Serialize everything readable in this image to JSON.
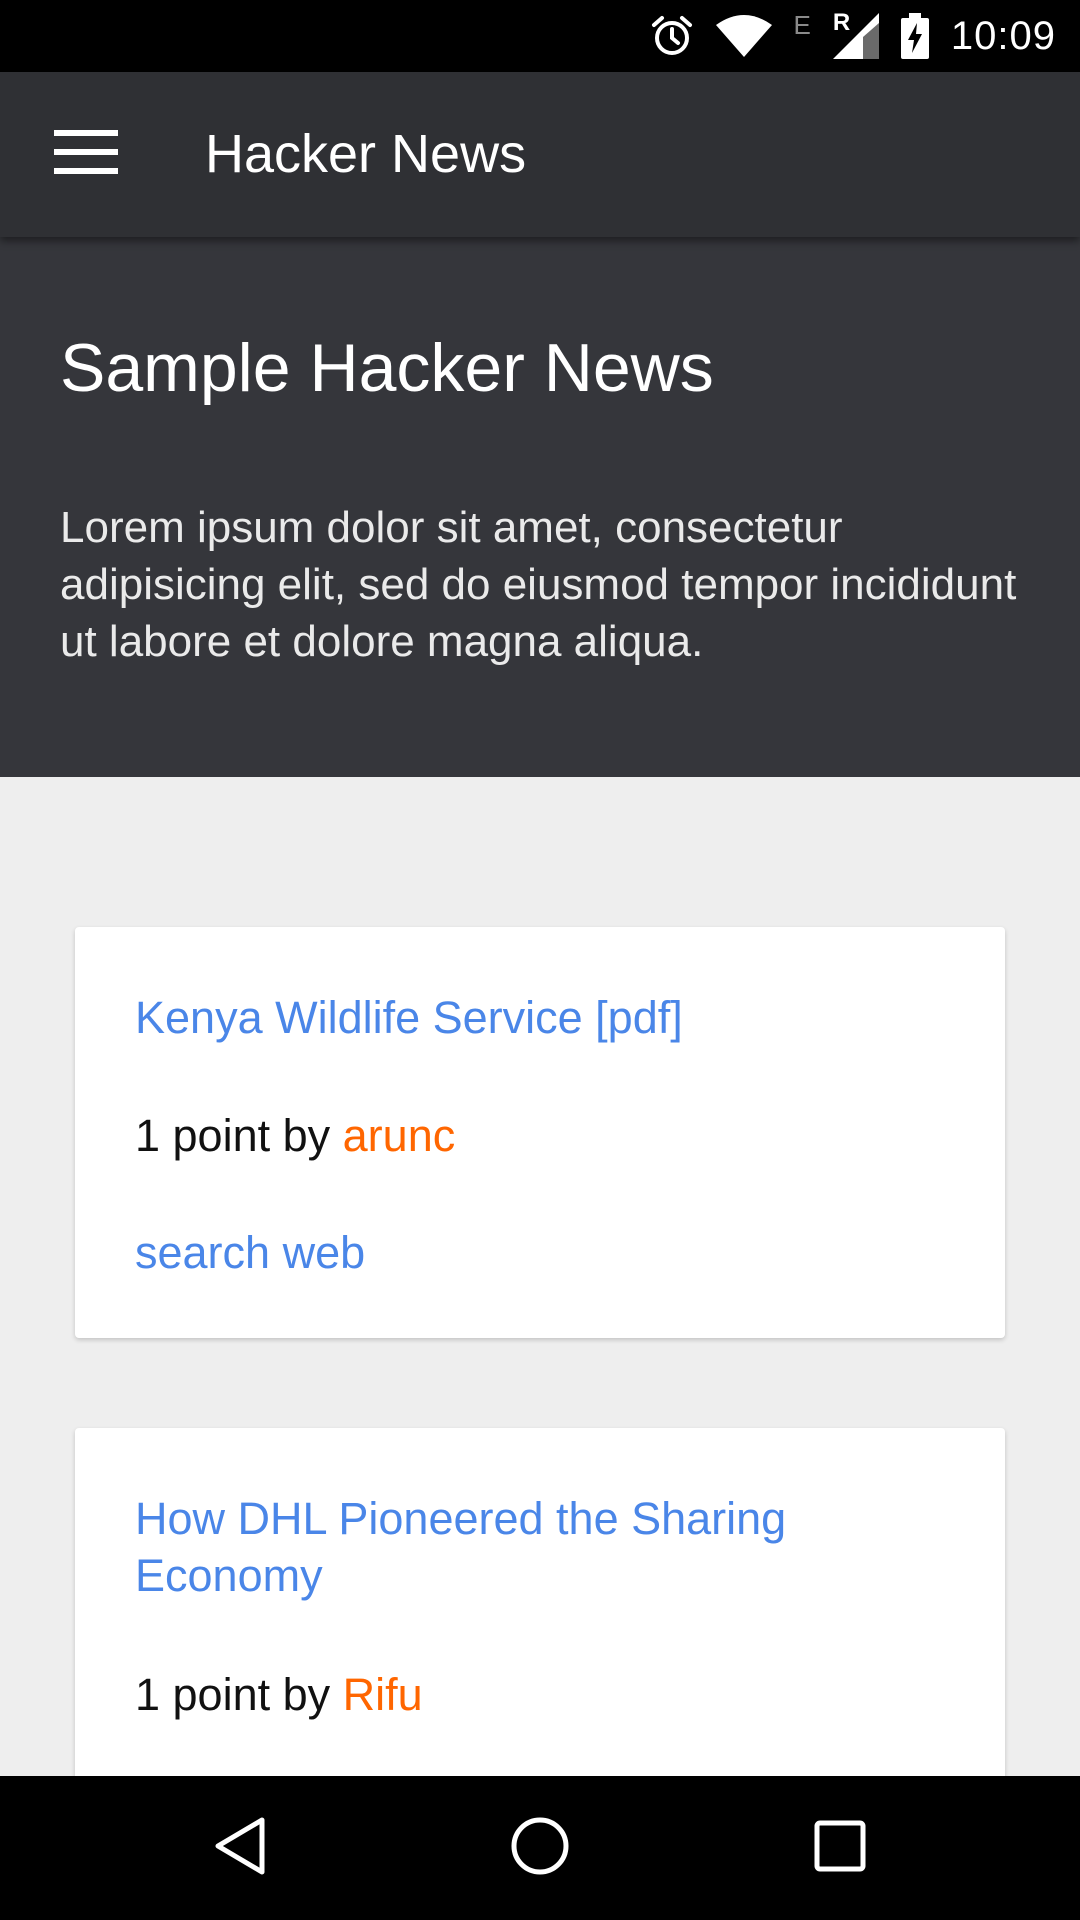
{
  "status_bar": {
    "time": "10:09",
    "network_label": "E",
    "roaming_label": "R",
    "icons": [
      "alarm-icon",
      "wifi-icon",
      "signal-icon",
      "battery-charging-icon"
    ]
  },
  "app_bar": {
    "title": "Hacker News",
    "menu_icon": "hamburger-menu-icon"
  },
  "hero": {
    "title": "Sample Hacker News",
    "text": "Lorem ipsum dolor sit amet, consectetur adipisicing elit, sed do eiusmod tempor incididunt ut labore et dolore magna aliqua."
  },
  "stories": [
    {
      "title": "Kenya Wildlife Service [pdf]",
      "meta_prefix": "1 point by ",
      "author": "arunc",
      "search_label": "search web"
    },
    {
      "title": "How DHL Pioneered the Sharing Economy",
      "meta_prefix": "1 point by ",
      "author": "Rifu"
    }
  ],
  "colors": {
    "link": "#4a86e8",
    "author": "#ff6600",
    "app_bar": "#2f3034",
    "hero": "#35363b",
    "background": "#eeeeee"
  },
  "nav_bar": {
    "icons": [
      "back-icon",
      "home-icon",
      "recents-icon"
    ]
  }
}
